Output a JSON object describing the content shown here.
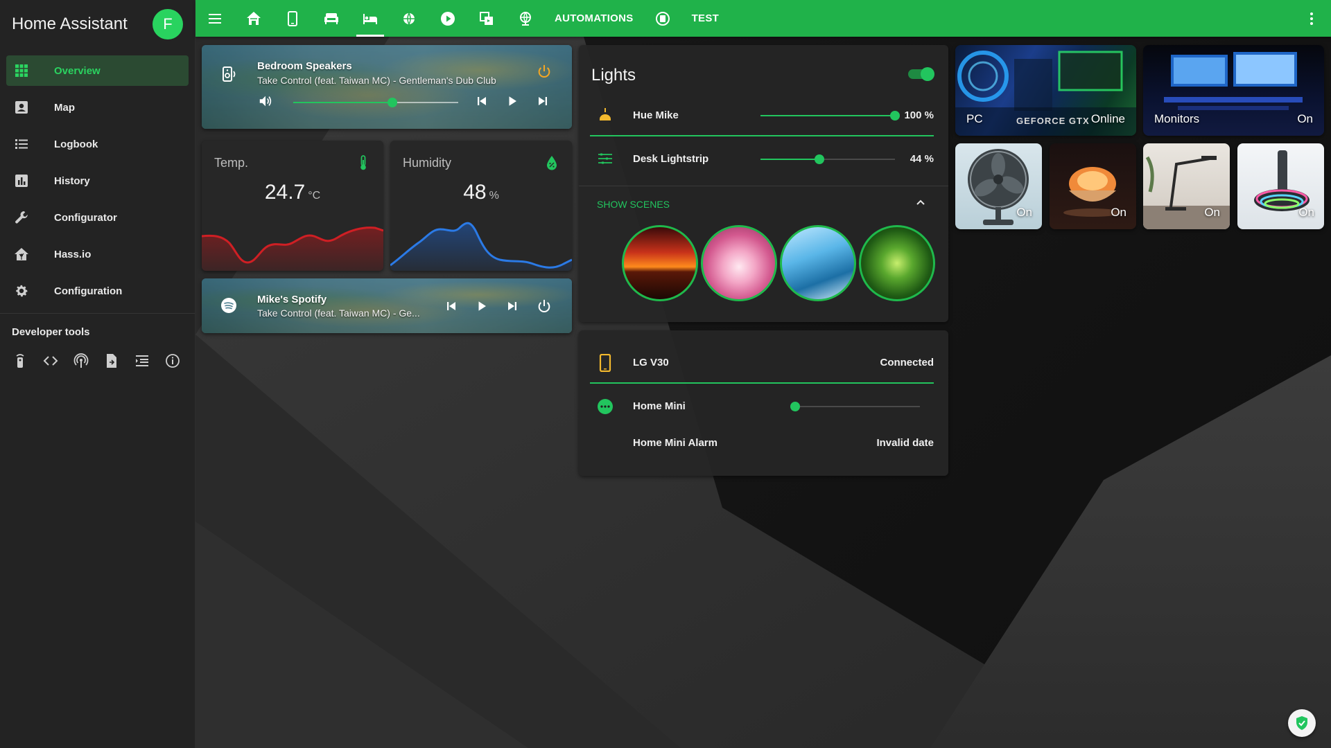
{
  "app": {
    "title": "Home Assistant",
    "avatar_initial": "F"
  },
  "colors": {
    "accent": "#22c55e",
    "topbar": "#20b24a",
    "sidebar": "#232323",
    "card": "#272727"
  },
  "sidebar": {
    "items": [
      {
        "label": "Overview",
        "icon": "grid-icon",
        "active": true
      },
      {
        "label": "Map",
        "icon": "map-person-icon"
      },
      {
        "label": "Logbook",
        "icon": "list-icon"
      },
      {
        "label": "History",
        "icon": "bar-chart-icon"
      },
      {
        "label": "Configurator",
        "icon": "wrench-icon"
      },
      {
        "label": "Hass.io",
        "icon": "hassio-icon"
      },
      {
        "label": "Configuration",
        "icon": "gear-icon"
      }
    ],
    "dev_tools_title": "Developer tools",
    "dev_tools_icons": [
      "remote-icon",
      "code-icon",
      "broadcast-icon",
      "file-export-icon",
      "template-icon",
      "info-icon"
    ]
  },
  "topbar": {
    "icons": [
      "menu-icon",
      "home-floor-icon",
      "phone-icon",
      "sofa-icon",
      "bed-icon",
      "weather-icon",
      "play-circle-icon",
      "copy-icon",
      "globe-icon"
    ],
    "active_icon": "bed-icon",
    "automations_label": "AUTOMATIONS",
    "test_icon": "test-badge-icon",
    "test_label": "TEST",
    "more_icon": "more-vertical-icon"
  },
  "bedroom_speakers": {
    "name": "Bedroom Speakers",
    "track": "Take Control (feat. Taiwan MC) - Gentleman's Dub Club",
    "volume": 0.6
  },
  "temp": {
    "name": "Temp.",
    "value": "24.7",
    "unit": "°C"
  },
  "humidity": {
    "name": "Humidity",
    "value": "48",
    "unit": "%"
  },
  "spotify": {
    "name": "Mike's Spotify",
    "track": "Take Control (feat. Taiwan MC) - Ge..."
  },
  "lights": {
    "title": "Lights",
    "toggle_on": true,
    "rows": [
      {
        "name": "Hue Mike",
        "value": "100 %",
        "level": 1.0
      },
      {
        "name": "Desk Lightstrip",
        "value": "44 %",
        "level": 0.44
      }
    ],
    "show_scenes": "SHOW SCENES",
    "scenes": [
      "sunset",
      "blossom",
      "ice",
      "green"
    ]
  },
  "devices": {
    "rows": [
      {
        "name": "LG V30",
        "state": "Connected"
      },
      {
        "name": "Home Mini",
        "volume": 0.0
      },
      {
        "name": "Home Mini Alarm",
        "state": "Invalid date"
      }
    ]
  },
  "tiles": {
    "pc": {
      "name": "PC",
      "state": "Online",
      "brand": "GEFORCE GTX"
    },
    "monitors": {
      "name": "Monitors",
      "state": "On"
    },
    "fan": {
      "state": "On"
    },
    "salt_lamp": {
      "state": "On"
    },
    "desk_lamp": {
      "state": "On"
    },
    "rgb_lamp": {
      "state": "On"
    }
  }
}
